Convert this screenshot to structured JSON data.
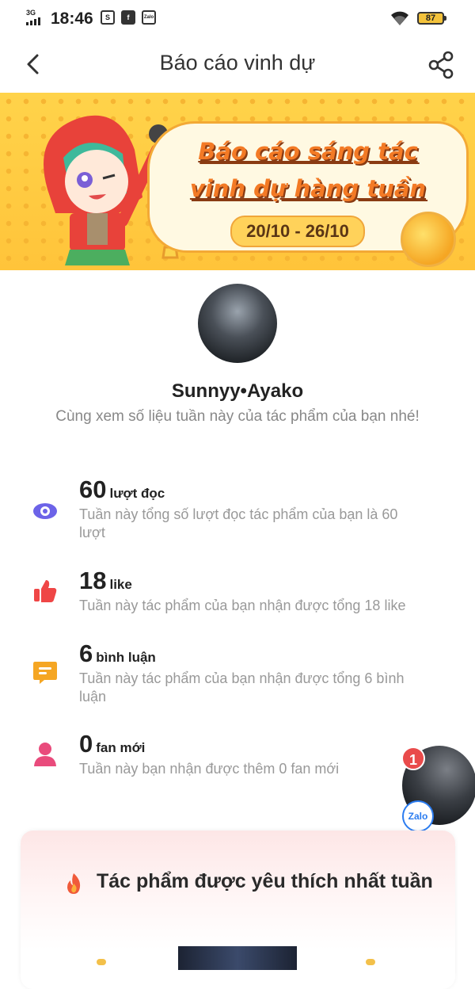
{
  "status_bar": {
    "network": "3G",
    "time": "18:46",
    "battery": "87",
    "app_icons": [
      "S",
      "f",
      "Zalo"
    ]
  },
  "nav": {
    "title": "Báo cáo vinh dự",
    "back_icon": "chevron-left-icon",
    "share_icon": "share-icon"
  },
  "banner": {
    "title_line1": "Báo cáo sáng tác",
    "title_line2": "vinh dự hàng tuần",
    "date_range": "20/10 - 26/10"
  },
  "profile": {
    "username": "Sunnyy•Ayako",
    "subtitle": "Cùng xem số liệu tuần này của tác phẩm của bạn nhé!"
  },
  "stats": [
    {
      "icon": "eye-icon",
      "number": "60",
      "unit": "lượt đọc",
      "desc": "Tuần này tổng số lượt đọc tác phẩm của bạn là 60 lượt",
      "color": "#6c63e8"
    },
    {
      "icon": "thumbs-up-icon",
      "number": "18",
      "unit": "like",
      "desc": "Tuần này tác phẩm của bạn nhận được tổng 18 like",
      "color": "#ef4646"
    },
    {
      "icon": "comment-icon",
      "number": "6",
      "unit": "bình luận",
      "desc": "Tuần này tác phẩm của bạn nhận được tổng 6 bình luận",
      "color": "#f5a623"
    },
    {
      "icon": "user-icon",
      "number": "0",
      "unit": "fan mới",
      "desc": "Tuần này bạn nhận được thêm 0 fan mới",
      "color": "#e94b7c"
    }
  ],
  "chat_head": {
    "badge": "1",
    "app": "Zalo"
  },
  "card": {
    "title": "Tác phẩm được yêu thích nhất tuần",
    "icon": "fire-icon"
  }
}
